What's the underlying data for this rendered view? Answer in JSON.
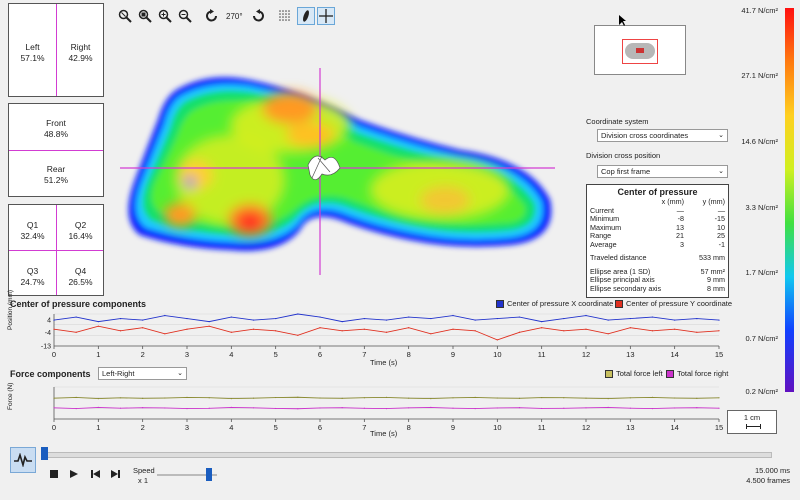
{
  "left_panel": {
    "left": {
      "label": "Left",
      "value": "57.1%"
    },
    "right": {
      "label": "Right",
      "value": "42.9%"
    },
    "front": {
      "label": "Front",
      "value": "48.8%"
    },
    "rear": {
      "label": "Rear",
      "value": "51.2%"
    },
    "q1": {
      "label": "Q1",
      "value": "32.4%"
    },
    "q2": {
      "label": "Q2",
      "value": "16.4%"
    },
    "q3": {
      "label": "Q3",
      "value": "24.7%"
    },
    "q4": {
      "label": "Q4",
      "value": "26.5%"
    }
  },
  "toolbar": {
    "rotation": "270°",
    "icons": [
      "zoom-fit-icon",
      "zoom-area-icon",
      "zoom-in-icon",
      "zoom-out-icon",
      "rotate-left-icon",
      "rotate-right-icon",
      "grid-icon",
      "footprint-icon",
      "crosshair-icon"
    ]
  },
  "settings": {
    "coordinate_system_label": "Coordinate system",
    "coordinate_system_value": "Division cross coordinates",
    "division_cross_label": "Division cross position",
    "division_cross_value": "Cop first frame"
  },
  "cop_table": {
    "title": "Center of pressure",
    "col_x": "x (mm)",
    "col_y": "y (mm)",
    "rows": [
      {
        "label": "Current",
        "x": "—",
        "y": "—"
      },
      {
        "label": "Minimum",
        "x": "-8",
        "y": "-15"
      },
      {
        "label": "Maximum",
        "x": "13",
        "y": "10"
      },
      {
        "label": "Range",
        "x": "21",
        "y": "25"
      },
      {
        "label": "Average",
        "x": "3",
        "y": "-1"
      }
    ],
    "traveled_label": "Traveled distance",
    "traveled_value": "533 mm",
    "ellipse_area_label": "Ellipse area (1 SD)",
    "ellipse_area_value": "57 mm²",
    "ellipse_principal_label": "Ellipse principal axis",
    "ellipse_principal_value": "9 mm",
    "ellipse_secondary_label": "Ellipse secondary axis",
    "ellipse_secondary_value": "8 mm"
  },
  "color_scale": {
    "labels": [
      "41.7 N/cm²",
      "27.1 N/cm²",
      "14.6 N/cm²",
      "3.3 N/cm²",
      "1.7 N/cm²",
      "0.7 N/cm²",
      "0.2 N/cm²"
    ]
  },
  "cop_chart": {
    "title": "Center of pressure components",
    "legend_x": "Center of pressure X coordinate",
    "legend_y": "Center of pressure Y coordinate",
    "color_x": "#2233cc",
    "color_y": "#e03020",
    "ylabel": "Position (mm)",
    "yticks": [
      "4",
      "-4",
      "-13"
    ],
    "xlabel": "Time (s)"
  },
  "force_chart": {
    "title": "Force components",
    "dropdown": "Left-Right",
    "legend_left": "Total force left",
    "legend_right": "Total force right",
    "color_left": "#8a8a30",
    "color_right": "#cc33cc",
    "ylabel": "Force (N)",
    "xlabel": "Time (s)"
  },
  "chart_data": [
    {
      "type": "line",
      "x": [
        0,
        0.5,
        1,
        1.5,
        2,
        2.5,
        3,
        3.5,
        4,
        4.5,
        5,
        5.5,
        6,
        6.5,
        7,
        7.5,
        8,
        8.5,
        9,
        9.5,
        10,
        10.5,
        11,
        11.5,
        12,
        12.5,
        13,
        13.5,
        14,
        14.5,
        15
      ],
      "series": [
        {
          "name": "Center of pressure X coordinate",
          "values": [
            4,
            6,
            3,
            5,
            4,
            7,
            5,
            3,
            6,
            4,
            5,
            8,
            6,
            3,
            5,
            4,
            6,
            5,
            7,
            4,
            5,
            6,
            3,
            5,
            7,
            4,
            5,
            6,
            4,
            5,
            4
          ]
        },
        {
          "name": "Center of pressure Y coordinate",
          "values": [
            -2,
            -4,
            0,
            -3,
            -1,
            -5,
            -2,
            0,
            -4,
            -2,
            -3,
            -6,
            -1,
            -3,
            -2,
            -4,
            -1,
            -5,
            -2,
            -3,
            -9,
            -4,
            -1,
            -3,
            -2,
            -5,
            -1,
            -3,
            -2,
            -4,
            -3
          ]
        }
      ],
      "title": "Center of pressure components",
      "xlabel": "Time (s)",
      "ylabel": "Position (mm)",
      "xlim": [
        0,
        15
      ],
      "ylim": [
        -13,
        8
      ]
    },
    {
      "type": "line",
      "x": [
        0,
        0.5,
        1,
        1.5,
        2,
        2.5,
        3,
        3.5,
        4,
        4.5,
        5,
        5.5,
        6,
        6.5,
        7,
        7.5,
        8,
        8.5,
        9,
        9.5,
        10,
        10.5,
        11,
        11.5,
        12,
        12.5,
        13,
        13.5,
        14,
        14.5,
        15
      ],
      "series": [
        {
          "name": "Total force left",
          "values": [
            460,
            470,
            455,
            465,
            458,
            462,
            470,
            466,
            455,
            460,
            468,
            472,
            462,
            458,
            466,
            470,
            460,
            455,
            465,
            470,
            462,
            458,
            468,
            466,
            460,
            455,
            465,
            470,
            462,
            458,
            465
          ]
        },
        {
          "name": "Total force right",
          "values": [
            340,
            330,
            345,
            335,
            342,
            338,
            330,
            334,
            345,
            340,
            332,
            328,
            338,
            342,
            334,
            330,
            340,
            345,
            335,
            330,
            338,
            342,
            332,
            334,
            340,
            345,
            335,
            330,
            338,
            342,
            335
          ]
        }
      ],
      "title": "Force components",
      "xlabel": "Time (s)",
      "ylabel": "Force (N)",
      "xlim": [
        0,
        15
      ],
      "ylim": [
        200,
        600
      ]
    }
  ],
  "xticks": [
    "0",
    "1",
    "2",
    "3",
    "4",
    "5",
    "6",
    "7",
    "8",
    "9",
    "10",
    "11",
    "12",
    "13",
    "14",
    "15"
  ],
  "scale_bar": "1 cm",
  "playback": {
    "speed_label": "Speed",
    "speed_value": "x 1",
    "duration": "15.000 ms",
    "frames": "4.500 frames"
  }
}
